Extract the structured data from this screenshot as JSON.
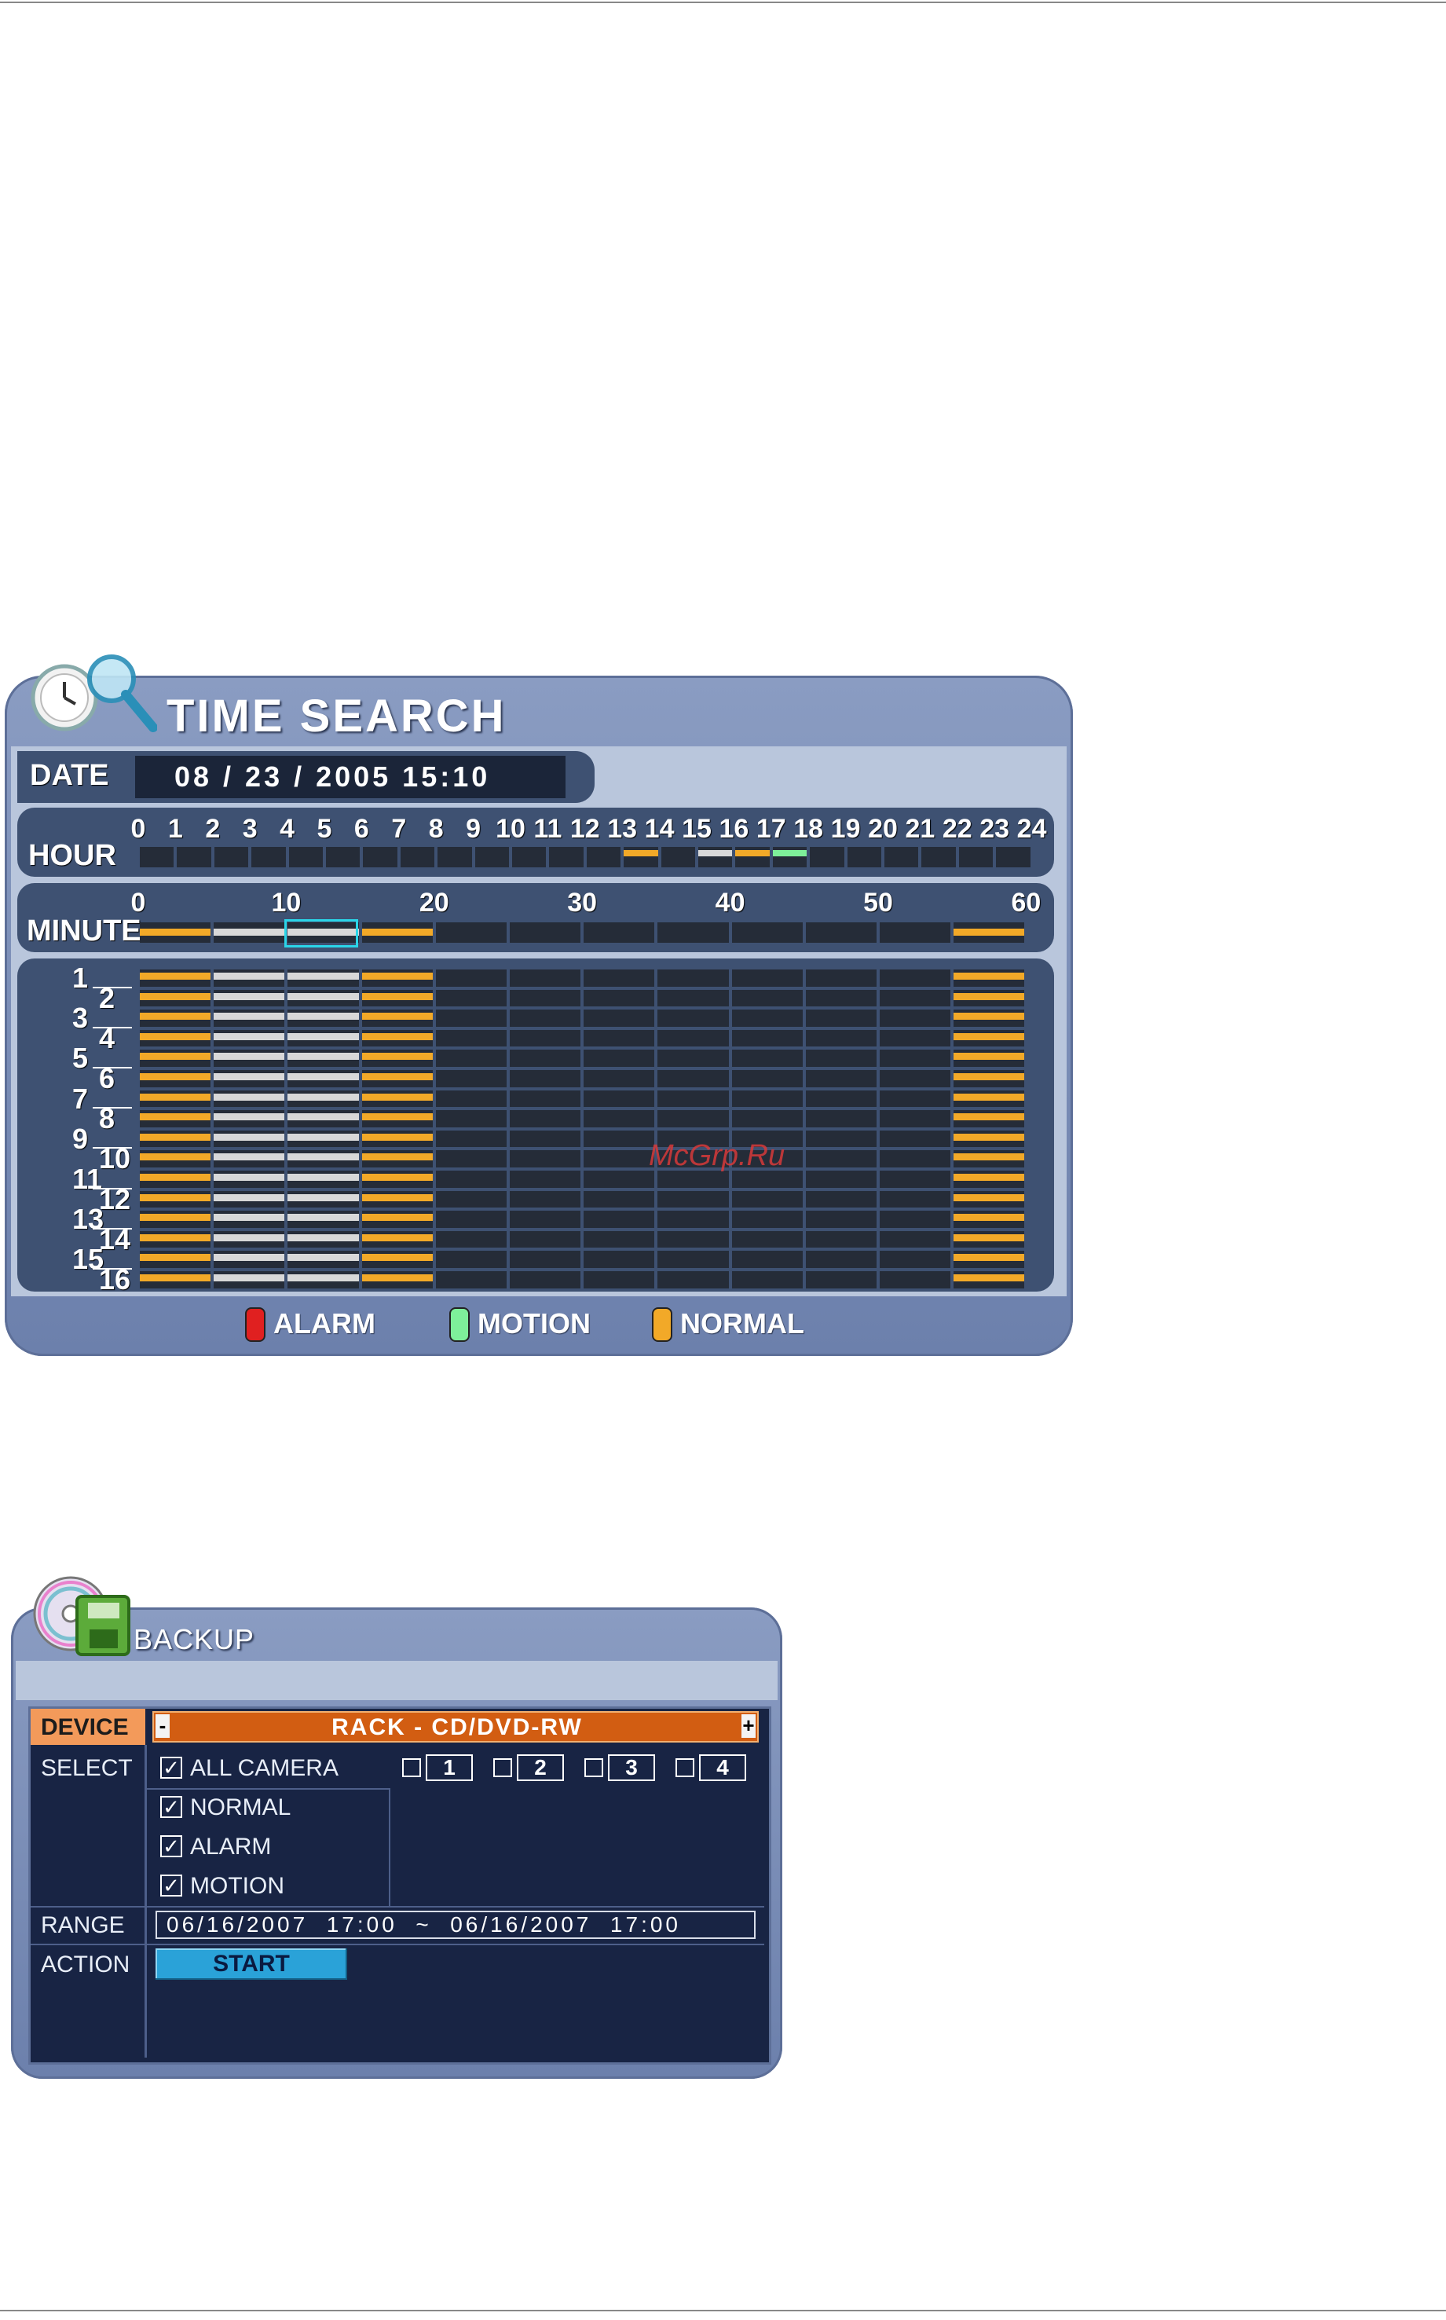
{
  "time_search": {
    "title": "TIME SEARCH",
    "date_label": "DATE",
    "date_value": "08 / 23 / 2005  15:10",
    "hour_label": "HOUR",
    "hour_ticks": [
      "0",
      "1",
      "2",
      "3",
      "4",
      "5",
      "6",
      "7",
      "8",
      "9",
      "10",
      "11",
      "12",
      "13",
      "14",
      "15",
      "16",
      "17",
      "18",
      "19",
      "20",
      "21",
      "22",
      "23",
      "24"
    ],
    "hour_records": [
      {
        "hour": 13,
        "type": "normal"
      },
      {
        "hour": 15,
        "type": "white"
      },
      {
        "hour": 16,
        "type": "normal"
      },
      {
        "hour": 17,
        "type": "motion"
      }
    ],
    "minute_label": "MINUTE",
    "minute_ticks": [
      "0",
      "10",
      "20",
      "30",
      "40",
      "50",
      "60"
    ],
    "minute_selected": 10,
    "channels": [
      "1",
      "2",
      "3",
      "4",
      "5",
      "6",
      "7",
      "8",
      "9",
      "10",
      "11",
      "12",
      "13",
      "14",
      "15",
      "16"
    ],
    "legend": [
      {
        "label": "ALARM",
        "color": "#e02020"
      },
      {
        "label": "MOTION",
        "color": "#7ef09a"
      },
      {
        "label": "NORMAL",
        "color": "#f2a928"
      }
    ],
    "watermark": "McGrp.Ru",
    "colors": {
      "normal": "#f2a928",
      "white": "#d8d8d8",
      "motion": "#7ef09a",
      "empty": "#252c38"
    }
  },
  "backup": {
    "title": "BACKUP",
    "device_label": "DEVICE",
    "device_value": "RACK - CD/DVD-RW",
    "minus": "-",
    "plus": "+",
    "select_label": "SELECT",
    "all_camera": "ALL CAMERA",
    "cameras": [
      "1",
      "2",
      "3",
      "4"
    ],
    "options": [
      "NORMAL",
      "ALARM",
      "MOTION"
    ],
    "check_mark": "✓",
    "range_label": "RANGE",
    "range_value": "06/16/2007  17:00  ~  06/16/2007  17:00",
    "action_label": "ACTION",
    "start_label": "START",
    "colors": {
      "device_label_bg": "#f39a5a",
      "device_bar": "#d25d12",
      "start_btn": "#2aa2d8"
    }
  }
}
